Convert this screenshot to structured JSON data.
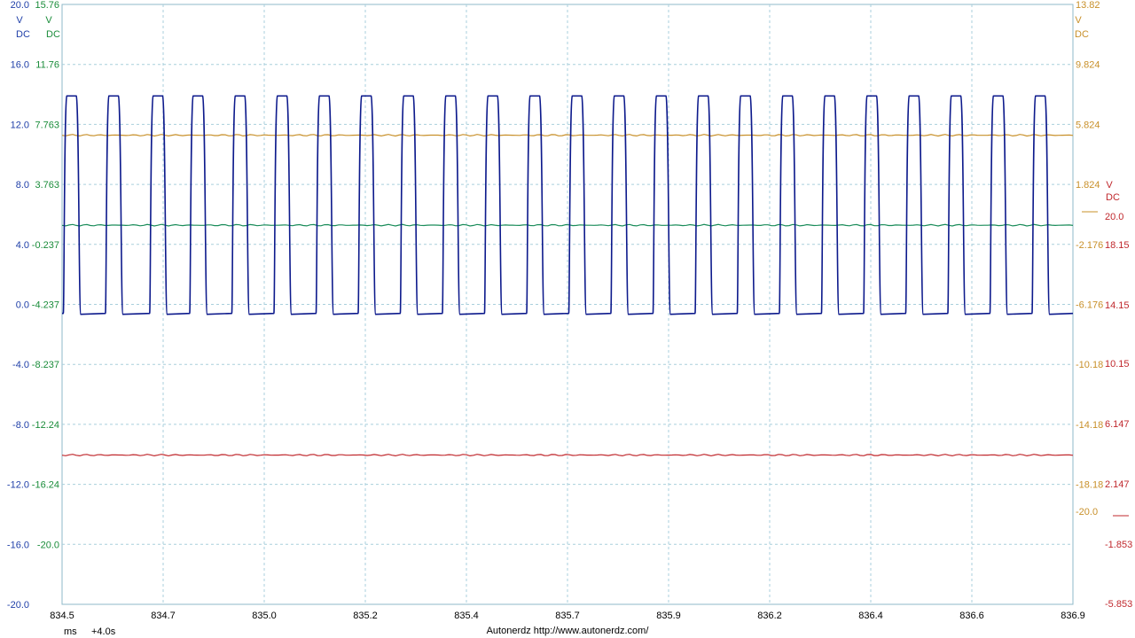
{
  "chart_data": {
    "type": "line",
    "x_axis": {
      "ticks": [
        "834.5",
        "834.7",
        "835.0",
        "835.2",
        "835.4",
        "835.7",
        "835.9",
        "836.2",
        "836.4",
        "836.6",
        "836.9"
      ],
      "range": [
        834.5,
        836.9
      ],
      "unit": "ms",
      "offset": "+4.0s"
    },
    "grid": true,
    "series": [
      {
        "color": "#0d1a8c",
        "axis": {
          "ticks": [
            "20.0",
            "16.0",
            "12.0",
            "8.0",
            "4.0",
            "0.0",
            "-4.0",
            "-8.0",
            "-12.0",
            "-16.0",
            "-20.0"
          ],
          "range": [
            -20,
            20
          ],
          "unit_lines": [
            "V",
            "DC"
          ],
          "color": "#1f3fa8"
        },
        "waveform": {
          "kind": "square",
          "high": 13.9,
          "low": -0.6,
          "pulse_starts": [
            834.505,
            834.605,
            834.71,
            834.805,
            834.905,
            835.005,
            835.105,
            835.205,
            835.305,
            835.405,
            835.505,
            835.605,
            835.705,
            835.805,
            835.905,
            836.005,
            836.105,
            836.205,
            836.305,
            836.405,
            836.505,
            836.605,
            836.705,
            836.805
          ],
          "pulse_width_ms": 0.035
        }
      },
      {
        "color": "#1a8c5a",
        "axis": {
          "ticks": [
            "15.76",
            "11.76",
            "7.763",
            "3.763",
            "-0.237",
            "-4.237",
            "-8.237",
            "-12.24",
            "-16.24",
            "-20.0"
          ],
          "range": [
            -24.24,
            15.76
          ],
          "unit_lines": [
            "V",
            "DC"
          ],
          "color": "#1a8c3a"
        },
        "waveform": {
          "kind": "flat",
          "value": 1.04
        }
      },
      {
        "color": "#c8902a",
        "axis": {
          "ticks": [
            "13.82",
            "9.824",
            "5.824",
            "1.824",
            "-2.176",
            "-6.176",
            "-10.18",
            "-14.18",
            "-18.18",
            "-20.0"
          ],
          "range": [
            -26.18,
            13.82
          ],
          "unit_lines": [
            "V",
            "DC"
          ],
          "color": "#c8902a"
        },
        "waveform": {
          "kind": "flat",
          "value": 5.1
        }
      },
      {
        "color": "#c0282d",
        "axis": {
          "ticks": [
            "20.0",
            "18.15",
            "14.15",
            "10.15",
            "6.147",
            "2.147",
            "-1.853",
            "-5.853"
          ],
          "range": [
            -5.853,
            34.147
          ],
          "unit_lines": [
            "V",
            "DC"
          ],
          "color": "#c0282d"
        },
        "waveform": {
          "kind": "flat",
          "value": 4.1
        }
      }
    ]
  },
  "footer": {
    "unit": "ms",
    "offset": "+4.0s",
    "credit": "Autonerdz  http://www.autonerdz.com/"
  }
}
